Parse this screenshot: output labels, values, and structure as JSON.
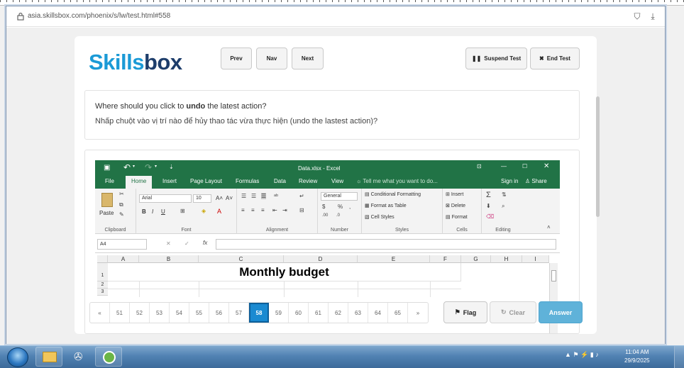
{
  "browser": {
    "url": "asia.skillsbox.com/phoenix/s/lw/test.html#558"
  },
  "logo": {
    "part1": "Skills",
    "part2": "box"
  },
  "nav": {
    "prev": "Prev",
    "nav": "Nav",
    "next": "Next",
    "suspend": "Suspend Test",
    "end": "End Test"
  },
  "question": {
    "prefix": "Where should you click to ",
    "bold": "undo",
    "suffix": " the latest action?",
    "line2": "Nhấp chuột vào vị trí nào để hủy thao tác vừa thực hiện (undo the lastest action)?"
  },
  "excel": {
    "title": "Data.xlsx - Excel",
    "tabs": [
      "File",
      "Home",
      "Insert",
      "Page Layout",
      "Formulas",
      "Data",
      "Review",
      "View"
    ],
    "tell_me": "Tell me what you want to do...",
    "sign_in": "Sign in",
    "share": "Share",
    "ribbon": {
      "paste": "Paste",
      "clipboard": "Clipboard",
      "font_name": "Arial",
      "font_size": "10",
      "font": "Font",
      "alignment": "Alignment",
      "number_format": "General",
      "number": "Number",
      "conditional": "Conditional Formatting",
      "format_table": "Format as Table",
      "cell_styles": "Cell Styles",
      "styles": "Styles",
      "insert": "Insert",
      "delete": "Delete",
      "format": "Format",
      "cells": "Cells",
      "editing": "Editing"
    },
    "name_box": "A4",
    "columns": [
      "A",
      "B",
      "C",
      "D",
      "E",
      "F",
      "G",
      "H",
      "I"
    ],
    "rows": [
      "1",
      "2",
      "3"
    ],
    "cell_title": "Monthly budget"
  },
  "pager": {
    "prev": "«",
    "pages": [
      "51",
      "52",
      "53",
      "54",
      "55",
      "56",
      "57",
      "58",
      "59",
      "60",
      "61",
      "62",
      "63",
      "64",
      "65"
    ],
    "current": "58",
    "next": "»"
  },
  "actions": {
    "flag": "Flag",
    "clear": "Clear",
    "answer": "Answer"
  },
  "taskbar": {
    "time": "11:04 AM",
    "date": "29/9/2025"
  },
  "colors": {
    "brand_blue": "#1b9ad6",
    "brand_dark": "#1d3d6b",
    "excel_green": "#217346",
    "answer_button": "#5fb2d9"
  }
}
